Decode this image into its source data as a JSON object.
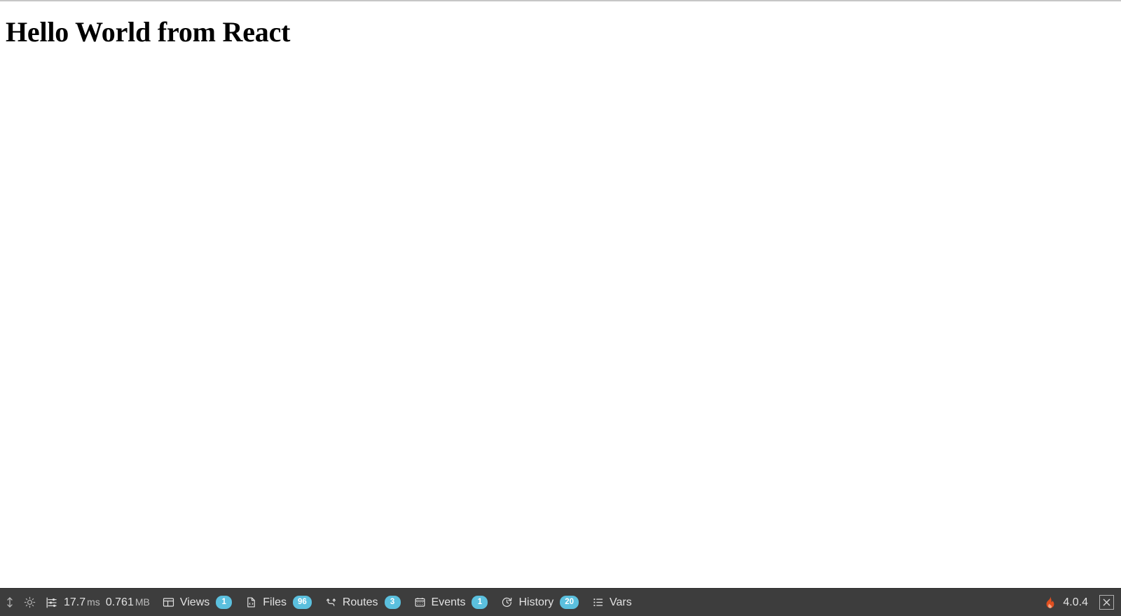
{
  "page": {
    "heading": "Hello World from React"
  },
  "debugbar": {
    "controls": {
      "resize_icon": "vertical-resize-arrows-icon",
      "theme_icon": "sun-brightness-icon"
    },
    "stats": {
      "icon": "sliders-timeline-icon",
      "time_value": "17.7",
      "time_unit": "ms",
      "memory_value": "0.761",
      "memory_unit": "MB"
    },
    "tabs": [
      {
        "name": "views",
        "icon": "layout-views-icon",
        "label": "Views",
        "badge": "1"
      },
      {
        "name": "files",
        "icon": "file-code-icon",
        "label": "Files",
        "badge": "96"
      },
      {
        "name": "routes",
        "icon": "route-branch-icon",
        "label": "Routes",
        "badge": "3"
      },
      {
        "name": "events",
        "icon": "calendar-icon",
        "label": "Events",
        "badge": "1"
      },
      {
        "name": "history",
        "icon": "clock-history-icon",
        "label": "History",
        "badge": "20"
      },
      {
        "name": "vars",
        "icon": "list-vars-icon",
        "label": "Vars",
        "badge": ""
      }
    ],
    "brand": {
      "icon": "flame-icon",
      "version": "4.0.4",
      "close_icon": "close-x-icon"
    },
    "colors": {
      "bar_background": "#3d3d3d",
      "badge_background": "#5bc0de",
      "text": "#e2e2e2",
      "flame": "#e04f20"
    }
  }
}
